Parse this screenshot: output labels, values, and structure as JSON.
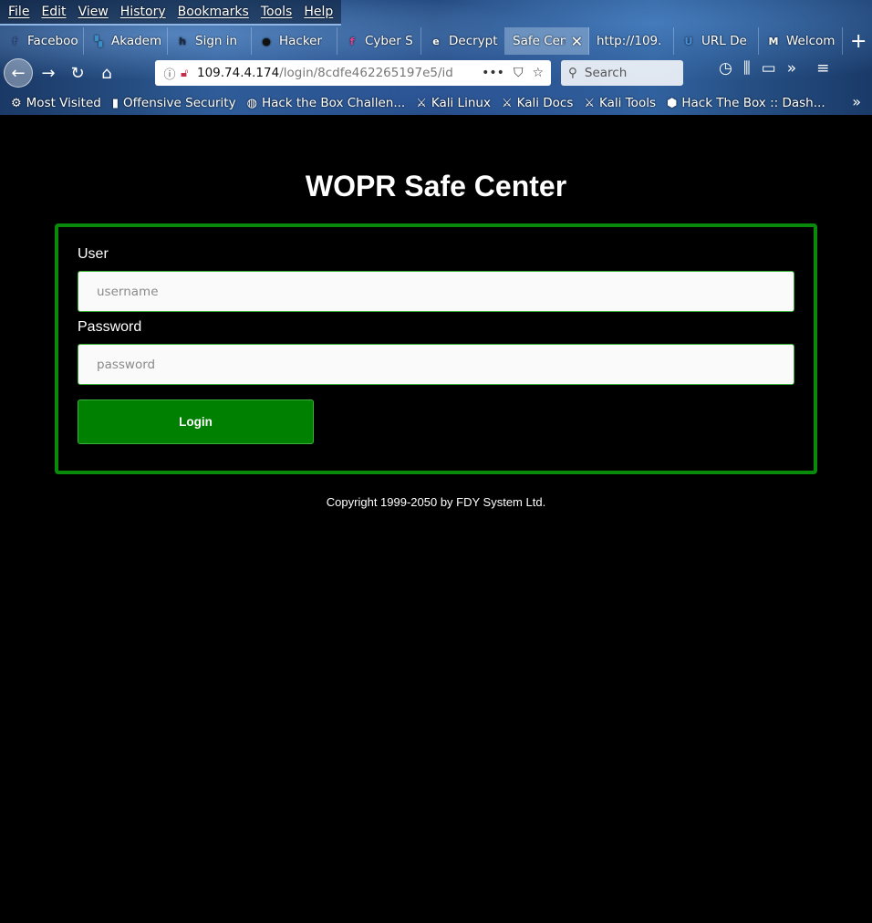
{
  "browser": {
    "menu": [
      "File",
      "Edit",
      "View",
      "History",
      "Bookmarks",
      "Tools",
      "Help"
    ],
    "tabs": [
      {
        "label": "Faceboo",
        "icon": "facebook-icon",
        "icon_glyph": "f",
        "icon_color": "#3b5998"
      },
      {
        "label": "Akadem",
        "icon": "akademy-icon",
        "icon_glyph": "▚",
        "icon_color": "#3a8fc8"
      },
      {
        "label": "Sign in",
        "icon": "signin-icon",
        "icon_glyph": "h",
        "icon_color": "#1a2a44"
      },
      {
        "label": "Hacker ",
        "icon": "hacker-icon",
        "icon_glyph": "●",
        "icon_color": "#111111"
      },
      {
        "label": "Cyber S",
        "icon": "cyber-icon",
        "icon_glyph": "f",
        "icon_color": "#e83e8c"
      },
      {
        "label": "Decrypt",
        "icon": "decrypt-icon",
        "icon_glyph": "e",
        "icon_color": "#ffffff"
      },
      {
        "label": "Safe Cen",
        "icon": "",
        "icon_glyph": "",
        "icon_color": "",
        "active": true
      },
      {
        "label": "http://109.",
        "icon": "",
        "icon_glyph": "",
        "icon_color": ""
      },
      {
        "label": "URL De",
        "icon": "url-decoder-icon",
        "icon_glyph": "U",
        "icon_color": "#4a90d9"
      },
      {
        "label": "Welcom",
        "icon": "gmail-icon",
        "icon_glyph": "M",
        "icon_color": "#ffffff"
      }
    ],
    "url_host": "109.74.4.174",
    "url_path": "/login/8cdfe462265197e5/id",
    "search_placeholder": "Search",
    "bookmarks": [
      {
        "label": "Most Visited",
        "icon": "gear-icon",
        "glyph": "⚙"
      },
      {
        "label": "Offensive Security",
        "icon": "offsec-icon",
        "glyph": "▮"
      },
      {
        "label": "Hack the Box Challen...",
        "icon": "globe-icon",
        "glyph": "◍"
      },
      {
        "label": "Kali Linux",
        "icon": "kali-icon",
        "glyph": "⚔"
      },
      {
        "label": "Kali Docs",
        "icon": "kali-icon",
        "glyph": "⚔"
      },
      {
        "label": "Kali Tools",
        "icon": "kali-icon",
        "glyph": "⚔"
      },
      {
        "label": "Hack The Box :: Dash...",
        "icon": "htb-icon",
        "glyph": "⬢"
      }
    ]
  },
  "page": {
    "title": "WOPR Safe Center",
    "user_label": "User",
    "user_placeholder": "username",
    "password_label": "Password",
    "password_placeholder": "password",
    "login_label": "Login",
    "copyright": "Copyright 1999-2050 by FDY System Ltd."
  },
  "colors": {
    "accent_green": "#008000",
    "border_green": "#0a8a0a",
    "background": "#000000"
  }
}
